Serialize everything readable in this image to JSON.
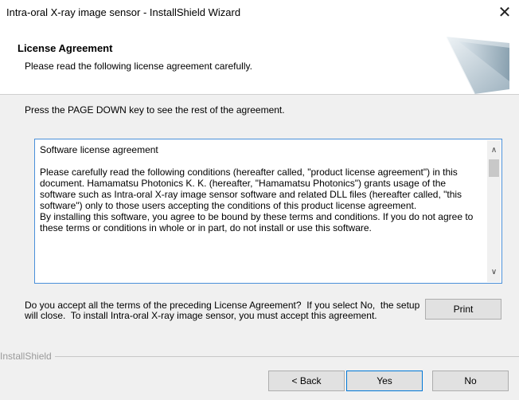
{
  "window": {
    "title": "Intra-oral X-ray image sensor - InstallShield Wizard",
    "close_glyph": "✕"
  },
  "header": {
    "title": "License Agreement",
    "subtitle": "Please read the following license agreement carefully."
  },
  "instructions": "Press the PAGE DOWN key to see the rest of the agreement.",
  "license_text": "Software license agreement\n\nPlease carefully read the following conditions (hereafter called, \"product license agreement\") in this document. Hamamatsu Photonics K. K. (hereafter, \"Hamamatsu Photonics\") grants usage of the software such as Intra-oral X-ray image sensor software and related DLL files (hereafter called, \"this software\") only to those users accepting the conditions of this product license agreement.\nBy installing this software, you agree to be bound by these terms and conditions. If you do not agree to these terms or conditions in whole or in part, do not install or use this software.",
  "scrollbar": {
    "up_glyph": "∧",
    "down_glyph": "∨"
  },
  "question": "Do you accept all the terms of the preceding License Agreement?  If you select No,  the setup will close.  To install Intra-oral X-ray image sensor, you must accept this agreement.",
  "buttons": {
    "print": "Print",
    "back": "< Back",
    "yes": "Yes",
    "no": "No"
  },
  "footer_brand": "InstallShield",
  "icons": {
    "close": "close-icon",
    "header_graphic": "wizard-header-graphic",
    "scroll_up": "scroll-up-icon",
    "scroll_down": "scroll-down-icon"
  },
  "colors": {
    "focus_border": "#0078d7",
    "license_border": "#4a90d9",
    "dialog_bg": "#f0f0f0"
  }
}
